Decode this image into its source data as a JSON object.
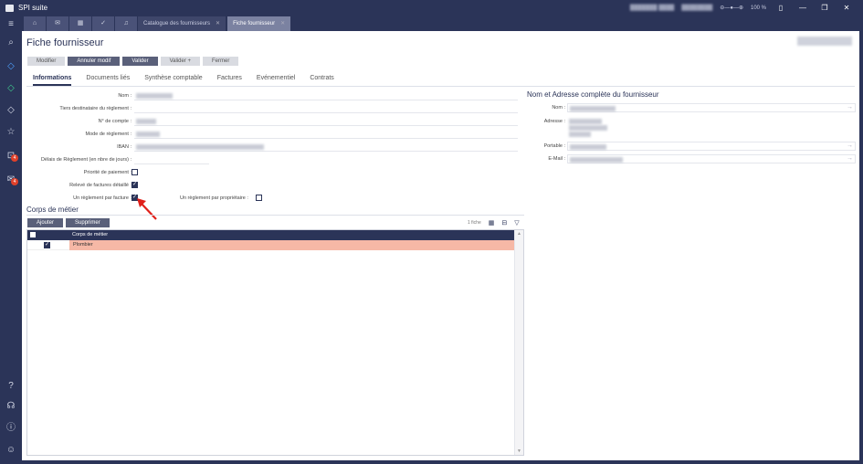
{
  "app": {
    "title": "SPI suite"
  },
  "tabs": [
    {
      "label": "Catalogue des fournisseurs",
      "active": false
    },
    {
      "label": "Fiche fournisseur",
      "active": true
    }
  ],
  "title_right": {
    "zoom": "100 %"
  },
  "page": {
    "title": "Fiche fournisseur"
  },
  "actions": [
    {
      "label": "Modifier",
      "style": "light"
    },
    {
      "label": "Annuler modif",
      "style": "dark"
    },
    {
      "label": "Valider",
      "style": "dark"
    },
    {
      "label": "Valider +",
      "style": "light"
    },
    {
      "label": "Fermer",
      "style": "light"
    }
  ],
  "section_tabs": [
    "Informations",
    "Documents liés",
    "Synthèse comptable",
    "Factures",
    "Evénementiel",
    "Contrats"
  ],
  "form": {
    "nom": "Nom :",
    "tiers": "Tiers destinataire du règlement :",
    "compte": "N° de compte :",
    "mode": "Mode de règlement :",
    "iban": "IBAN :",
    "delais": "Délais de Règlement (en nbre de jours) :",
    "priorite": "Priorité de paiement :",
    "releve": "Relevé de factures détaillé :",
    "reglement_facture": "Un règlement par facture :",
    "reglement_proprietaire": "Un règlement par propriétaire :"
  },
  "address": {
    "title": "Nom et Adresse complète du fournisseur",
    "nom": "Nom :",
    "adresse": "Adresse :",
    "portable": "Portable :",
    "email": "E-Mail :"
  },
  "corps": {
    "title": "Corps de métier",
    "add": "Ajouter",
    "remove": "Supprimer",
    "count": "1 fiche",
    "column": "Corps de métier",
    "rows": [
      {
        "label": "Plombier",
        "checked": true
      }
    ]
  }
}
